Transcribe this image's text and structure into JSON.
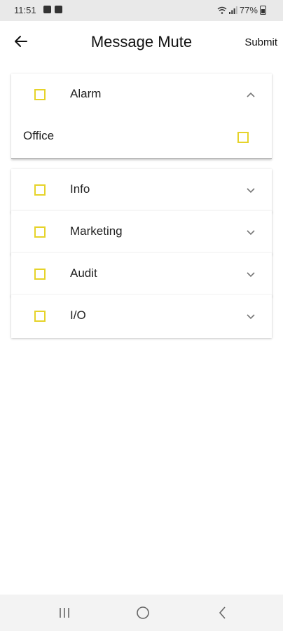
{
  "status_bar": {
    "time": "11:51",
    "battery": "77%"
  },
  "app_bar": {
    "title": "Message Mute",
    "submit_label": "Submit"
  },
  "categories": [
    {
      "label": "Alarm",
      "expanded": true,
      "items": [
        {
          "label": "Office"
        }
      ]
    },
    {
      "label": "Info",
      "expanded": false
    },
    {
      "label": "Marketing",
      "expanded": false
    },
    {
      "label": "Audit",
      "expanded": false
    },
    {
      "label": "I/O",
      "expanded": false
    }
  ],
  "colors": {
    "checkbox_border": "#e6d32a",
    "status_bar_bg": "#e9e9e9",
    "nav_bar_bg": "#f3f3f3"
  },
  "icons": {
    "back": "arrow-left-icon",
    "expand": "chevron-down-icon",
    "collapse": "chevron-up-icon",
    "recents": "recents-icon",
    "home": "home-circle-icon",
    "nav_back": "nav-back-icon"
  }
}
